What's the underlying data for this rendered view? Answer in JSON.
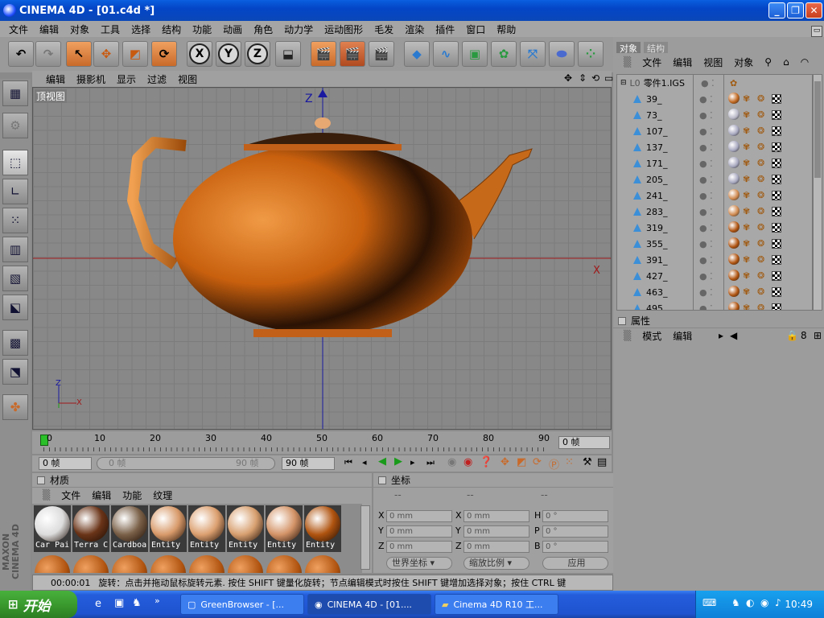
{
  "window": {
    "title": "CINEMA 4D - [01.c4d *]",
    "minimize_icon": "minimize-icon",
    "maximize_icon": "restore-icon",
    "close_icon": "close-icon"
  },
  "menu": [
    "文件",
    "编辑",
    "对象",
    "工具",
    "选择",
    "结构",
    "功能",
    "动画",
    "角色",
    "动力学",
    "运动图形",
    "毛发",
    "渲染",
    "插件",
    "窗口",
    "帮助"
  ],
  "toolbar": {
    "axis_labels": [
      "X",
      "Y",
      "Z"
    ]
  },
  "viewport": {
    "menu": [
      "编辑",
      "摄影机",
      "显示",
      "过滤",
      "视图"
    ],
    "label": "顶视图",
    "axis_z": "Z",
    "axis_x": "X",
    "gizmo_z": "Z",
    "gizmo_x": "X"
  },
  "timeline": {
    "ticks": [
      "0",
      "10",
      "20",
      "30",
      "40",
      "50",
      "60",
      "70",
      "80",
      "90"
    ],
    "current_frame": "0 帧",
    "start_field": "0 帧",
    "range_start": "0 帧",
    "range_end": "90 帧",
    "end_field": "90 帧"
  },
  "materials": {
    "title": "材质",
    "menu": [
      "文件",
      "编辑",
      "功能",
      "纹理"
    ],
    "items": [
      {
        "label": "Car Pai",
        "color": "#dcdcdc"
      },
      {
        "label": "Terra C",
        "color": "#6a3418"
      },
      {
        "label": "Cardboa",
        "color": "#7a6048"
      },
      {
        "label": "Entity",
        "color": "#d89a6a"
      },
      {
        "label": "Entity",
        "color": "#dca070"
      },
      {
        "label": "Entity",
        "color": "#d8a070"
      },
      {
        "label": "Entity",
        "color": "#d49468"
      },
      {
        "label": "Entity",
        "color": "#b05410"
      }
    ]
  },
  "coords": {
    "title": "坐标",
    "headers": [
      "--",
      "--",
      "--"
    ],
    "rows": [
      {
        "a": "X",
        "av": "0 mm",
        "b": "X",
        "bv": "0 mm",
        "c": "H",
        "cv": "0 °"
      },
      {
        "a": "Y",
        "av": "0 mm",
        "b": "Y",
        "bv": "0 mm",
        "c": "P",
        "cv": "0 °"
      },
      {
        "a": "Z",
        "av": "0 mm",
        "b": "Z",
        "bv": "0 mm",
        "c": "B",
        "cv": "0 °"
      }
    ],
    "mode": "世界坐标",
    "scale": "缩放比例",
    "apply": "应用"
  },
  "status": {
    "time": "00:00:01",
    "text": "旋转：点击并拖动鼠标旋转元素. 按住 SHIFT 键量化旋转；节点编辑模式时按住 SHIFT 键增加选择对象；按住 CTRL 键"
  },
  "objects": {
    "tabs": [
      "对象",
      "结构"
    ],
    "menu": [
      "文件",
      "编辑",
      "视图",
      "对象"
    ],
    "root": "零件1.IGS",
    "rows": [
      {
        "name": "39_",
        "mat": "#c06820"
      },
      {
        "name": "73_",
        "mat": "#b8b8c8"
      },
      {
        "name": "107_",
        "mat": "#a8a8c0"
      },
      {
        "name": "137_",
        "mat": "#a8a8c0"
      },
      {
        "name": "171_",
        "mat": "#a8a8c0"
      },
      {
        "name": "205_",
        "mat": "#a8a8c0"
      },
      {
        "name": "241_",
        "mat": "#d08a50"
      },
      {
        "name": "283_",
        "mat": "#d08a50"
      },
      {
        "name": "319_",
        "mat": "#b05410"
      },
      {
        "name": "355_",
        "mat": "#b05410"
      },
      {
        "name": "391_",
        "mat": "#b05410"
      },
      {
        "name": "427_",
        "mat": "#b05410"
      },
      {
        "name": "463_",
        "mat": "#b05410"
      },
      {
        "name": "495_",
        "mat": "#b05410"
      }
    ]
  },
  "attributes": {
    "title": "属性",
    "menu": [
      "模式",
      "编辑"
    ]
  },
  "taskbar": {
    "start": "开始",
    "tasks": [
      "GreenBrowser - [...",
      "CINEMA 4D - [01....",
      "Cinema 4D R10 工..."
    ],
    "clock": "10:49"
  }
}
